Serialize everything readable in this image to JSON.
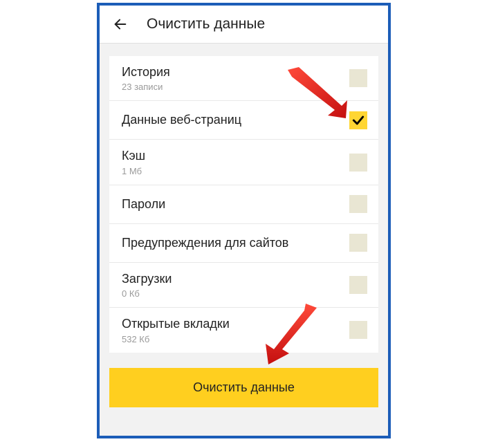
{
  "header": {
    "title": "Очистить данные"
  },
  "items": [
    {
      "label": "История",
      "sub": "23 записи",
      "checked": false
    },
    {
      "label": "Данные веб-страниц",
      "sub": "",
      "checked": true
    },
    {
      "label": "Кэш",
      "sub": "1 Мб",
      "checked": false
    },
    {
      "label": "Пароли",
      "sub": "",
      "checked": false
    },
    {
      "label": "Предупреждения для сайтов",
      "sub": "",
      "checked": false
    },
    {
      "label": "Загрузки",
      "sub": "0 Кб",
      "checked": false
    },
    {
      "label": "Открытые вкладки",
      "sub": "532 Кб",
      "checked": false
    }
  ],
  "action": {
    "label": "Очистить данные"
  }
}
